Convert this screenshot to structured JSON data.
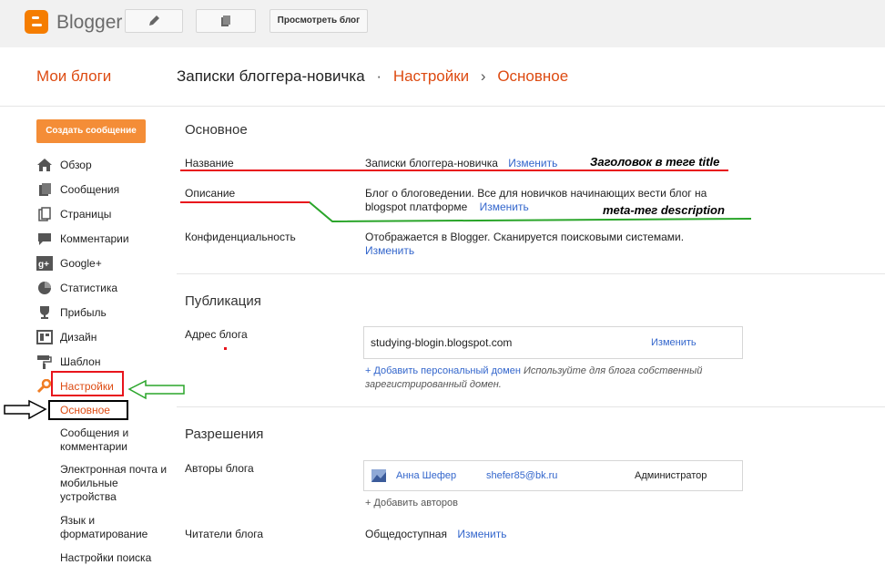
{
  "topbar": {
    "app_name": "Blogger",
    "edit_icon": "pencil-icon",
    "pages_icon": "pages-icon",
    "view_blog_label": "Просмотреть блог"
  },
  "header": {
    "my_blogs": "Мои блоги",
    "blog_title": "Записки блоггера-новичка",
    "dot": "·",
    "settings": "Настройки",
    "chevron": "›",
    "current": "Основное"
  },
  "sidebar": {
    "create_post": "Создать сообщение",
    "items": [
      {
        "label": "Обзор",
        "icon": "home-icon"
      },
      {
        "label": "Сообщения",
        "icon": "posts-icon"
      },
      {
        "label": "Страницы",
        "icon": "pages-icon"
      },
      {
        "label": "Комментарии",
        "icon": "comment-icon"
      },
      {
        "label": "Google+",
        "icon": "google-plus-icon"
      },
      {
        "label": "Статистика",
        "icon": "stats-icon"
      },
      {
        "label": "Прибыль",
        "icon": "trophy-icon"
      },
      {
        "label": "Дизайн",
        "icon": "layout-icon"
      },
      {
        "label": "Шаблон",
        "icon": "paint-roller-icon"
      },
      {
        "label": "Настройки",
        "icon": "wrench-icon"
      }
    ],
    "subitems": [
      "Основное",
      "Сообщения и комментарии",
      "Электронная почта и мобильные устройства",
      "Язык и форматирование",
      "Настройки поиска"
    ]
  },
  "basic": {
    "heading": "Основное",
    "title_label": "Название",
    "title_value": "Записки блоггера-новичка",
    "change": "Изменить",
    "desc_label": "Описание",
    "desc_value": "Блог о блоговедении. Все для новичков начинающих вести блог на blogspot платформе",
    "privacy_label": "Конфиденциальность",
    "privacy_value": "Отображается в Blogger. Сканируется поисковыми системами."
  },
  "publishing": {
    "heading": "Публикация",
    "address_label": "Адрес блога",
    "address_value": "studying-blogin.blogspot.com",
    "change": "Изменить",
    "add_domain": "+ Добавить персональный домен",
    "domain_note": "Используйте для блога собственный зарегистрированный домен."
  },
  "permissions": {
    "heading": "Разрешения",
    "authors_label": "Авторы блога",
    "author_name": "Анна Шефер",
    "author_email": "shefer85@bk.ru",
    "author_role": "Администратор",
    "add_authors": "+ Добавить авторов",
    "readers_label": "Читатели блога",
    "readers_value": "Общедоступная",
    "change": "Изменить"
  },
  "annotations": {
    "title_tag": "Заголовок в теге title",
    "meta_desc": "meta-тег description"
  },
  "colors": {
    "accent": "#dd4b12",
    "button": "#f48d37",
    "link": "#3366cc",
    "red": "#e8141c",
    "green": "#2aa52a"
  }
}
